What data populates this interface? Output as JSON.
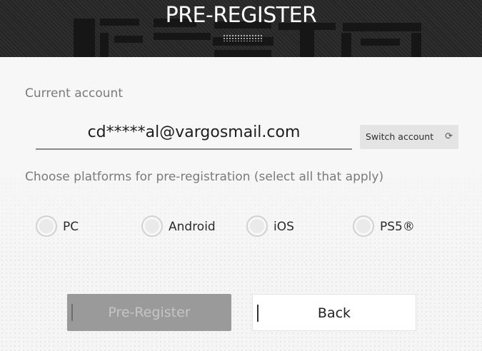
{
  "header": {
    "title": "PRE-REGISTER"
  },
  "account": {
    "label": "Current account",
    "email": "cd*****al@vargosmail.com",
    "switch_label": "Switch account",
    "switch_icon": "refresh-icon"
  },
  "platforms": {
    "label": "Choose platforms for pre-registration (select all that apply)",
    "options": [
      {
        "label": "PC",
        "selected": false
      },
      {
        "label": "Android",
        "selected": false
      },
      {
        "label": "iOS",
        "selected": false
      },
      {
        "label": "PS5®",
        "selected": false
      }
    ]
  },
  "buttons": {
    "pre_register": "Pre-Register",
    "back": "Back"
  },
  "colors": {
    "header_bg": "#262626",
    "disabled_button": "#9a9a9a",
    "back_button": "#ffffff"
  }
}
